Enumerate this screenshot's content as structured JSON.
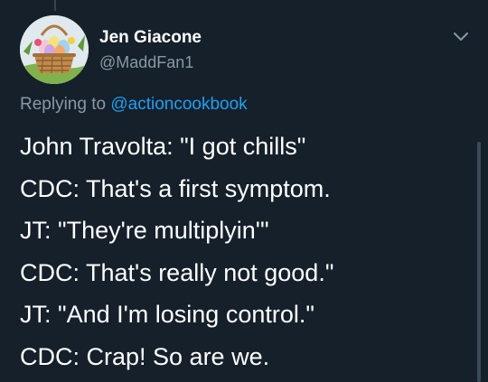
{
  "tweet": {
    "display_name": "Jen Giacone",
    "handle": "@MaddFan1",
    "reply_prefix": "Replying to ",
    "reply_to": "@actioncookbook",
    "avatar": "easter-basket-avatar",
    "lines": [
      "John Travolta: \"I got chills\"",
      "CDC: That's a first symptom.",
      "JT: \"They're multiplyin'\"",
      "CDC: That's really not good.\"",
      "JT: \"And I'm losing control.\"",
      "CDC: Crap! So are we."
    ]
  },
  "icons": {
    "more": "chevron-down-icon"
  },
  "colors": {
    "background": "#15202b",
    "primary_text": "#ffffff",
    "secondary_text": "#8899a6",
    "accent": "#1da1f2"
  }
}
